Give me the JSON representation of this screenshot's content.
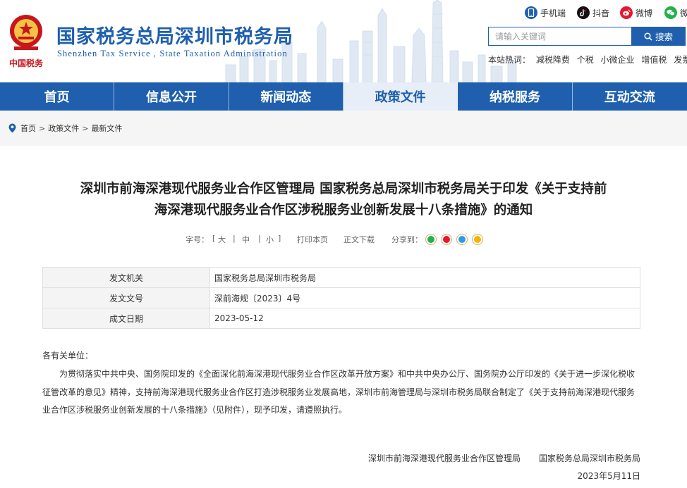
{
  "header": {
    "title": "国家税务总局深圳市税务局",
    "subtitle": "Shenzhen Tax Service , State Taxation Administration",
    "logo_text": "中国税务"
  },
  "social": [
    {
      "label": "手机端",
      "icon": "mobile-icon",
      "color": "#1f5fae"
    },
    {
      "label": "抖音",
      "icon": "douyin-icon",
      "color": "#111111"
    },
    {
      "label": "微博",
      "icon": "weibo-icon",
      "color": "#e6162d"
    },
    {
      "label": "微信",
      "icon": "wechat-icon",
      "color": "#22b14c"
    }
  ],
  "search": {
    "placeholder": "请输入关键词",
    "button": "搜索"
  },
  "hotwords": {
    "label": "本站热词：",
    "items": [
      "减税降费",
      "个税",
      "小微企业",
      "增值税",
      "发票"
    ]
  },
  "nav": {
    "items": [
      "首页",
      "信息公开",
      "新闻动态",
      "政策文件",
      "纳税服务",
      "互动交流"
    ],
    "active": "政策文件"
  },
  "breadcrumb": {
    "items": [
      "首页",
      "政策文件",
      "最新文件"
    ],
    "separator": ">"
  },
  "article": {
    "title_line1": "深圳市前海深港现代服务业合作区管理局 国家税务总局深圳市税务局关于印发《关于支持前",
    "title_line2": "海深港现代服务业合作区涉税服务业创新发展十八条措施》的通知",
    "tools": {
      "font_label": "字号：",
      "bracket_open": "[",
      "bracket_close": "]",
      "pipe": "|",
      "large": "大",
      "medium": "中",
      "small": "小",
      "print": "打印本页",
      "download": "正文下载",
      "share": "分享到："
    },
    "meta": [
      {
        "key": "发文机关",
        "value": "国家税务总局深圳市税务局"
      },
      {
        "key": "发文文号",
        "value": "深前海规〔2023〕4号"
      },
      {
        "key": "成文日期",
        "value": "2023-05-12"
      }
    ],
    "greeting": "各有关单位：",
    "paragraph": "为贯彻落实中共中央、国务院印发的《全面深化前海深港现代服务业合作区改革开放方案》和中共中央办公厅、国务院办公厅印发的《关于进一步深化税收征管改革的意见》精神，支持前海深港现代服务业合作区打造涉税服务业发展高地，深圳市前海管理局与深圳市税务局联合制定了《关于支持前海深港现代服务业合作区涉税服务业创新发展的十八条措施》（见附件），现予印发，请遵照执行。",
    "signers": [
      "深圳市前海深港现代服务业合作区管理局",
      "国家税务总局深圳市税务局"
    ],
    "date": "2023年5月11日"
  },
  "colors": {
    "brand": "#1f5fae",
    "nav_active_bg": "#e8eef7",
    "crumb_bg": "#f5f5f5",
    "logo_red": "#c8161d"
  }
}
